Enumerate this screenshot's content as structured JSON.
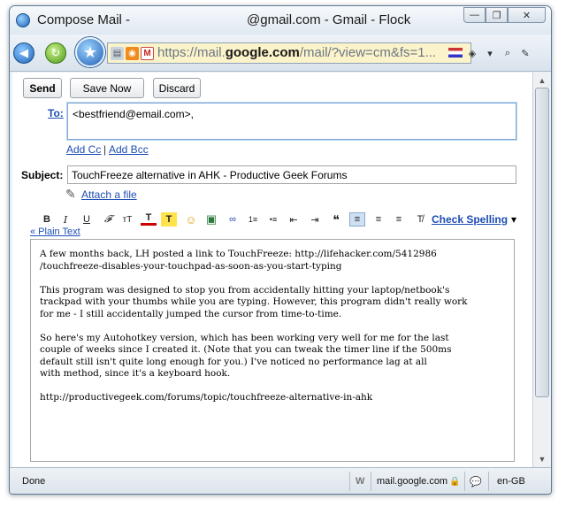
{
  "window": {
    "title_left": "Compose Mail -",
    "title_right": "@gmail.com - Gmail - Flock",
    "controls": {
      "minimize": "—",
      "maximize": "❐",
      "close": "✕"
    }
  },
  "navbar": {
    "url_prefix": "https://mail.",
    "url_domain": "google.com",
    "url_suffix": "/mail/?view=cm&fs=1..."
  },
  "compose": {
    "send_label": "Send",
    "save_label": "Save Now",
    "discard_label": "Discard",
    "to_label": "To:",
    "to_value": "<bestfriend@email.com>,",
    "add_cc": "Add Cc",
    "separator": "|",
    "add_bcc": "Add Bcc",
    "subject_label": "Subject:",
    "subject_value": "TouchFreeze alternative in AHK - Productive Geek Forums",
    "attach_label": "Attach a file",
    "check_spelling": "Check Spelling",
    "plain_text": "« Plain Text",
    "body": [
      "A few months back, LH posted a link to TouchFreeze: http://lifehacker.com/5412986\n/touchfreeze-disables-your-touchpad-as-soon-as-you-start-typing",
      "This program was designed to stop you from accidentally hitting your laptop/netbook's\ntrackpad with your thumbs while you are typing. However, this program didn't really work\nfor me - I still accidentally jumped the cursor from time-to-time.",
      "So here's my Autohotkey version, which has been working very well for me for the last\ncouple of weeks since I created it. (Note that you can tweak the timer line if the 500ms\ndefault still isn't quite long enough for you.) I've noticed no performance lag at all\nwith method, since it's a keyboard hook.",
      "http://productivegeek.com/forums/topic/touchfreeze-alternative-in-ahk"
    ]
  },
  "toolbar": {
    "bold": "B",
    "italic": "I",
    "underline": "U",
    "font": "𝓕",
    "size": "тT",
    "text_color": "T",
    "highlight": "T",
    "emoticon": "☺",
    "image": "▣",
    "link": "∞",
    "numbered": "1≡",
    "bulleted": "•≡",
    "outdent": "⇤",
    "indent": "⇥",
    "quote": "❝",
    "align_left": "≡",
    "align_center": "≡",
    "align_right": "≡",
    "clear": "T̸",
    "dropdown": "▾"
  },
  "status": {
    "text": "Done",
    "w_icon": "W",
    "domain": "mail.google.com",
    "lock": "🔒",
    "chat": "💬",
    "locale": "en-GB"
  },
  "colors": {
    "link": "#1c4db3",
    "url_bar_bg": "#fbf3c9",
    "window_border": "#5a7a99"
  }
}
